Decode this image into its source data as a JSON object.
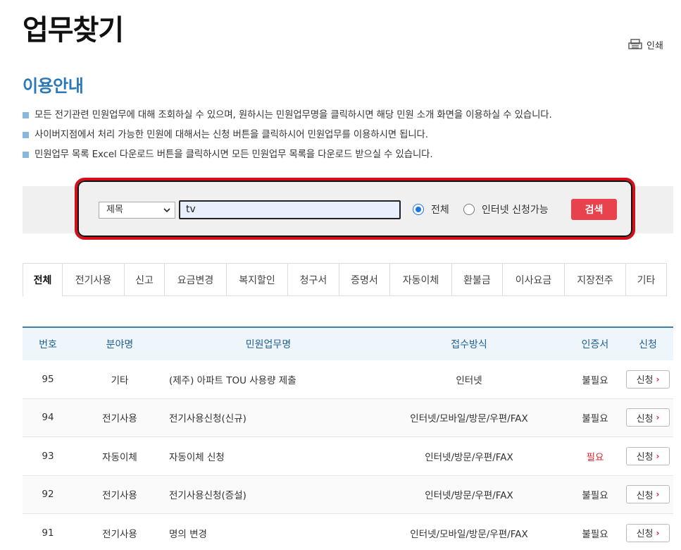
{
  "page": {
    "title": "업무찾기",
    "print_label": "인쇄"
  },
  "guide": {
    "title": "이용안내",
    "items": [
      "모든 전기관련 민원업무에 대해 조회하실 수 있으며, 원하시는 민원업무명을 클릭하시면 해당 민원 소개 화면을 이용하실 수 있습니다.",
      "사이버지점에서 처리 가능한 민원에 대해서는 신청 버튼을 클릭하시어 민원업무를 이용하시면 됩니다.",
      "민원업무 목록 Excel 다운로드 버튼을 클릭하시면 모든 민원업무 목록을 다운로드 받으실 수 있습니다."
    ]
  },
  "search": {
    "select_value": "제목",
    "input_value": "tv",
    "radio_all": "전체",
    "radio_net": "인터넷 신청가능",
    "button": "검색",
    "accent": "#e8424c",
    "highlight": "#d40f18"
  },
  "tabs": [
    "전체",
    "전기사용",
    "신고",
    "요금변경",
    "복지할인",
    "청구서",
    "증명서",
    "자동이체",
    "환불금",
    "이사요금",
    "지장전주",
    "기타"
  ],
  "table": {
    "headers": [
      "번호",
      "분야명",
      "민원업무명",
      "접수방식",
      "인증서",
      "신청"
    ],
    "apply_label": "신청",
    "rows": [
      {
        "no": "95",
        "field": "기타",
        "name": "(제주) 아파트 TOU 사용량 제출",
        "method": "인터넷",
        "cert": "불필요"
      },
      {
        "no": "94",
        "field": "전기사용",
        "name": "전기사용신청(신규)",
        "method": "인터넷/모바일/방문/우편/FAX",
        "cert": "불필요"
      },
      {
        "no": "93",
        "field": "자동이체",
        "name": "자동이체 신청",
        "method": "인터넷/방문/우편/FAX",
        "cert": "필요"
      },
      {
        "no": "92",
        "field": "전기사용",
        "name": "전기사용신청(증설)",
        "method": "인터넷/방문/우편/FAX",
        "cert": "불필요"
      },
      {
        "no": "91",
        "field": "전기사용",
        "name": "명의 변경",
        "method": "인터넷/모바일/방문/우편/FAX",
        "cert": "불필요"
      }
    ]
  }
}
